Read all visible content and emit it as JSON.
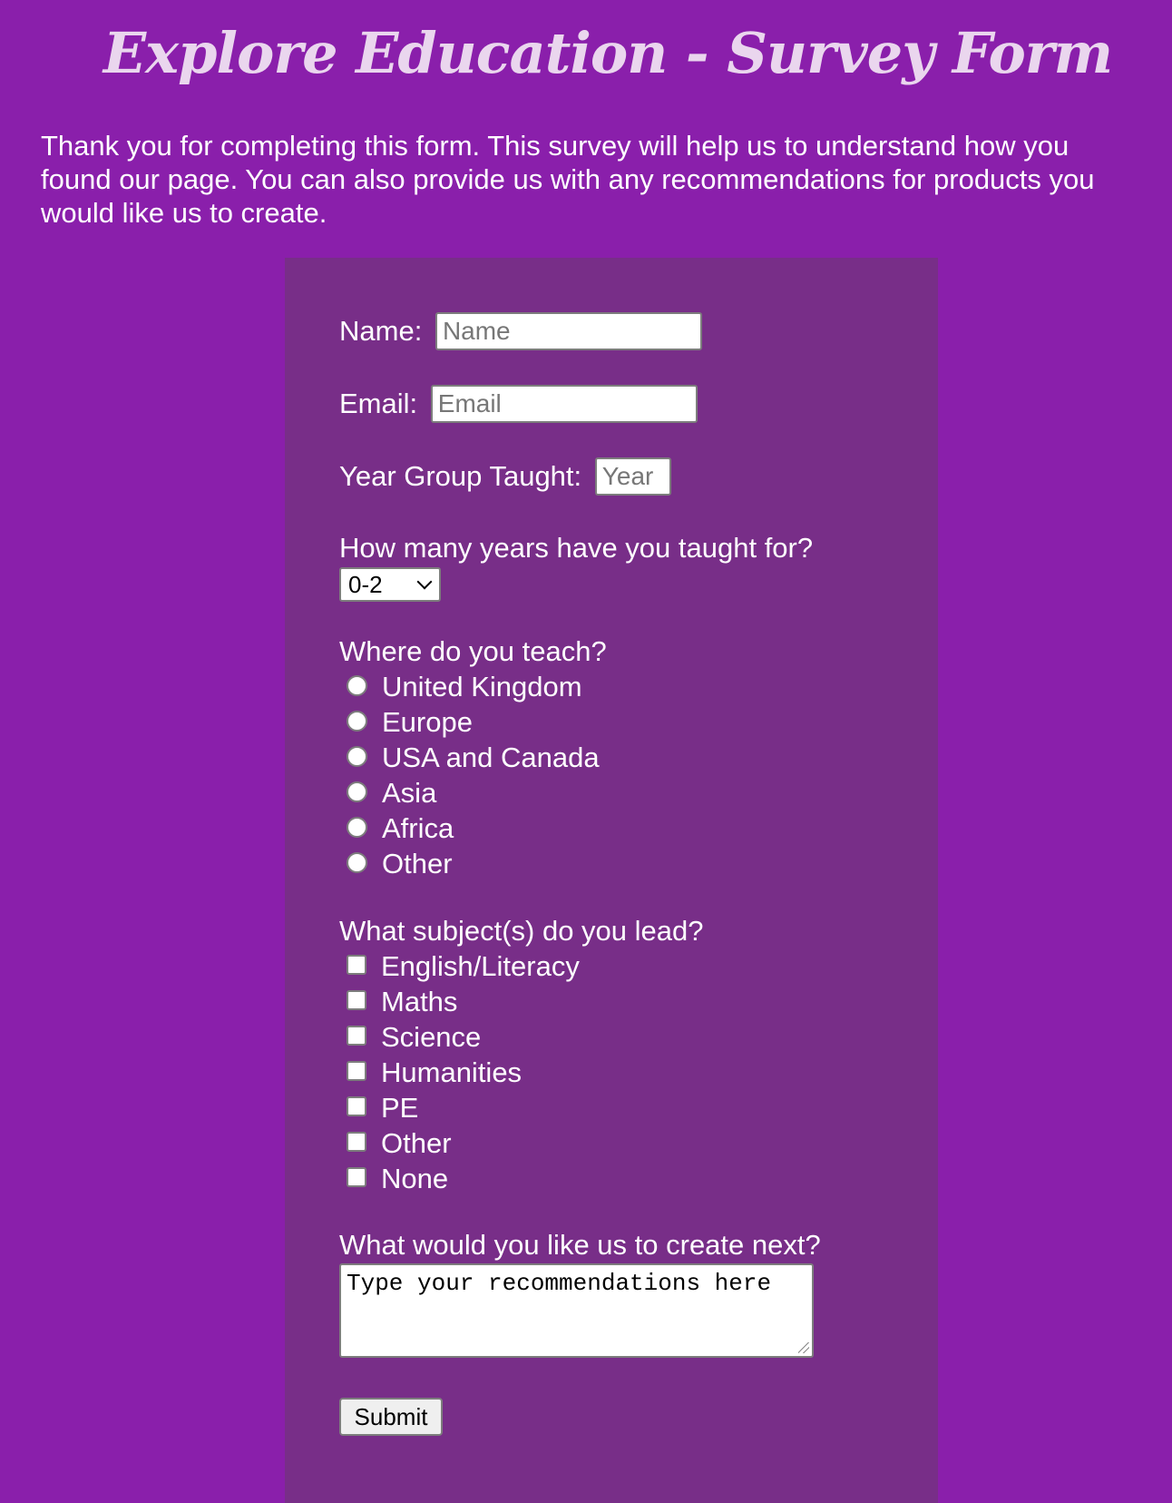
{
  "page": {
    "title": "Explore Education - Survey Form",
    "intro": "Thank you for completing this form. This survey will help us to understand how you found our page. You can also provide us with any recommendations for products you would like us to create."
  },
  "form": {
    "name": {
      "label": "Name:",
      "placeholder": "Name",
      "value": ""
    },
    "email": {
      "label": "Email:",
      "placeholder": "Email",
      "value": ""
    },
    "year_group": {
      "label": "Year Group Taught:",
      "placeholder": "Year",
      "value": ""
    },
    "years_taught": {
      "label": "How many years have you taught for?",
      "selected": "0-2"
    },
    "location": {
      "label": "Where do you teach?",
      "options": [
        "United Kingdom",
        "Europe",
        "USA and Canada",
        "Asia",
        "Africa",
        "Other"
      ]
    },
    "subjects": {
      "label": "What subject(s) do you lead?",
      "options": [
        "English/Literacy",
        "Maths",
        "Science",
        "Humanities",
        "PE",
        "Other",
        "None"
      ]
    },
    "recommendations": {
      "label": "What would you like us to create next?",
      "placeholder": "Type your recommendations here"
    },
    "submit_label": "Submit"
  },
  "colors": {
    "page_background": "#8a1fab",
    "panel_background": "#782e88",
    "title_color": "#ead6ee",
    "text_color": "#ffffff"
  }
}
